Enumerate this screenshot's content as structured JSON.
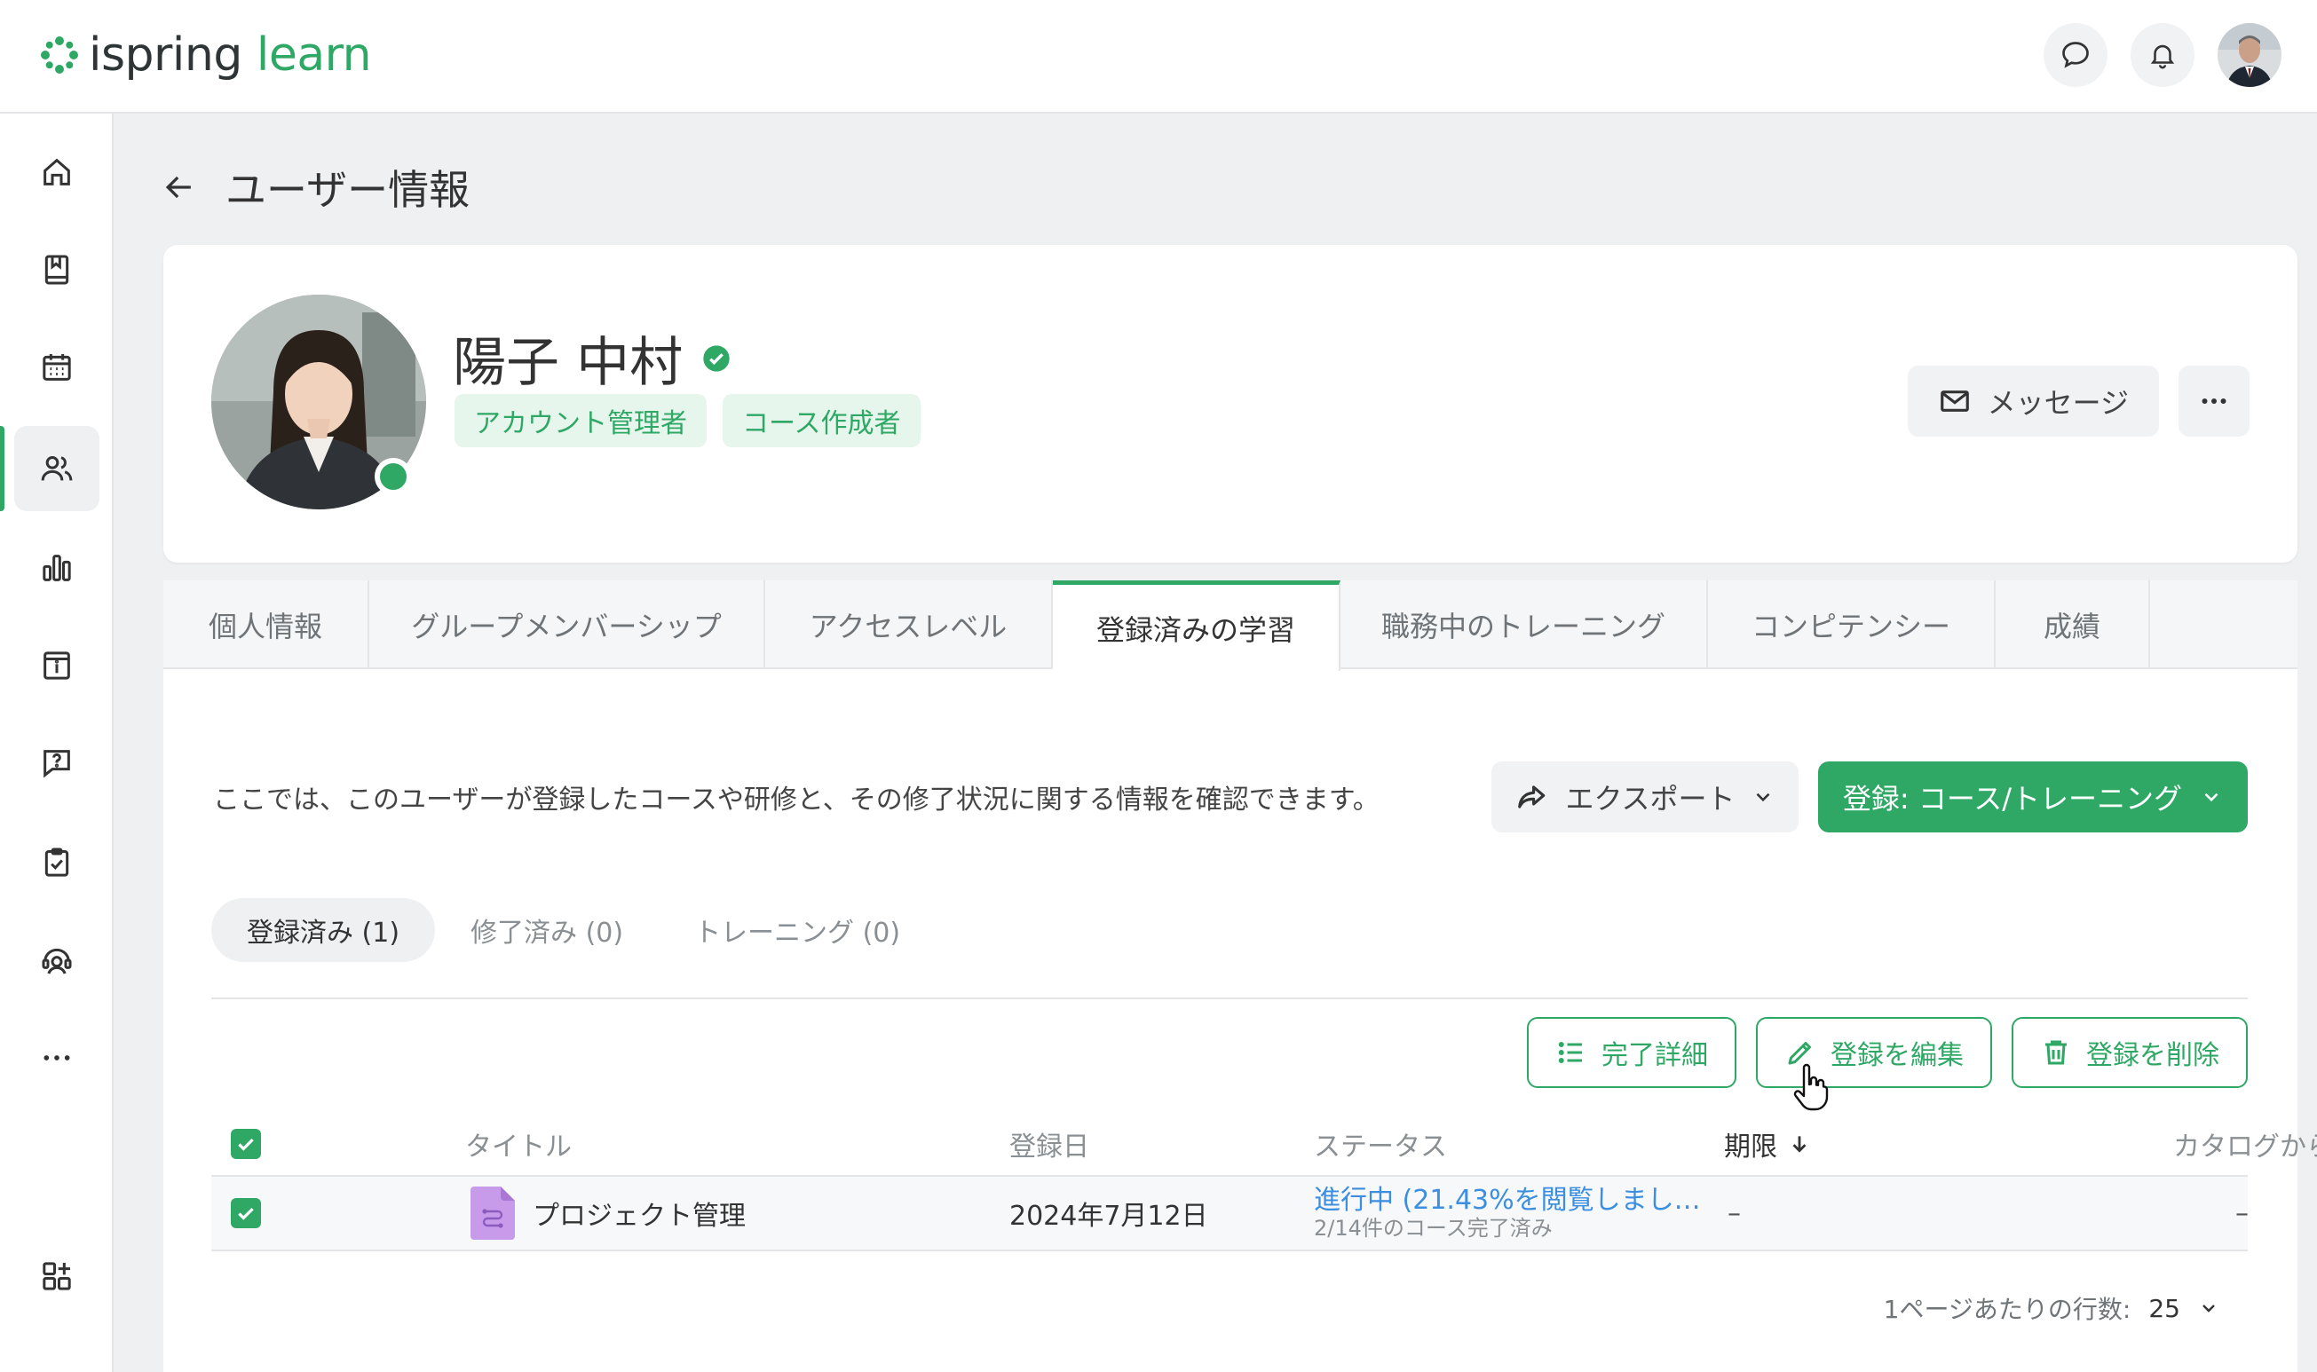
{
  "app": {
    "logo_a": "ispring",
    "logo_b": "learn",
    "brand_color": "#2fa866"
  },
  "topbar": {
    "icons": [
      "chat-bubble-icon",
      "bell-icon"
    ]
  },
  "sidebar": {
    "items": [
      "home-icon",
      "book-icon",
      "calendar-icon",
      "users-icon",
      "bar-chart-icon",
      "info-board-icon",
      "question-chat-icon",
      "clipboard-check-icon",
      "support-agent-icon",
      "more-dots-icon",
      "add-app-icon"
    ],
    "active": "users-icon"
  },
  "page": {
    "title": "ユーザー情報"
  },
  "profile": {
    "name": "陽子 中村",
    "roles": [
      "アカウント管理者",
      "コース作成者"
    ],
    "message_label": "メッセージ"
  },
  "tabs": [
    "個人情報",
    "グループメンバーシップ",
    "アクセスレベル",
    "登録済みの学習",
    "職務中のトレーニング",
    "コンピテンシー",
    "成績"
  ],
  "content": {
    "description": "ここでは、このユーザーが登録したコースや研修と、その修了状況に関する情報を確認できます。",
    "export_label": "エクスポート",
    "enroll_label": "登録:  コース/トレーニング",
    "subtabs": [
      "登録済み (1)",
      "修了済み (0)",
      "トレーニング (0)"
    ],
    "actions": {
      "details": "完了詳細",
      "edit": "登録を編集",
      "delete": "登録を削除"
    }
  },
  "table": {
    "headers": {
      "title": "タイトル",
      "date": "登録日",
      "status": "ステータス",
      "deadline": "期限",
      "catalog": "カタログから"
    },
    "rows": [
      {
        "title": "プロジェクト管理",
        "date": "2024年7月12日",
        "status": "進行中 (21.43%を閲覧しまし…",
        "status_sub": "2/14件のコース完了済み",
        "deadline": "–",
        "catalog": "–"
      }
    ]
  },
  "pager": {
    "label": "1ページあたりの行数:",
    "value": "25"
  }
}
